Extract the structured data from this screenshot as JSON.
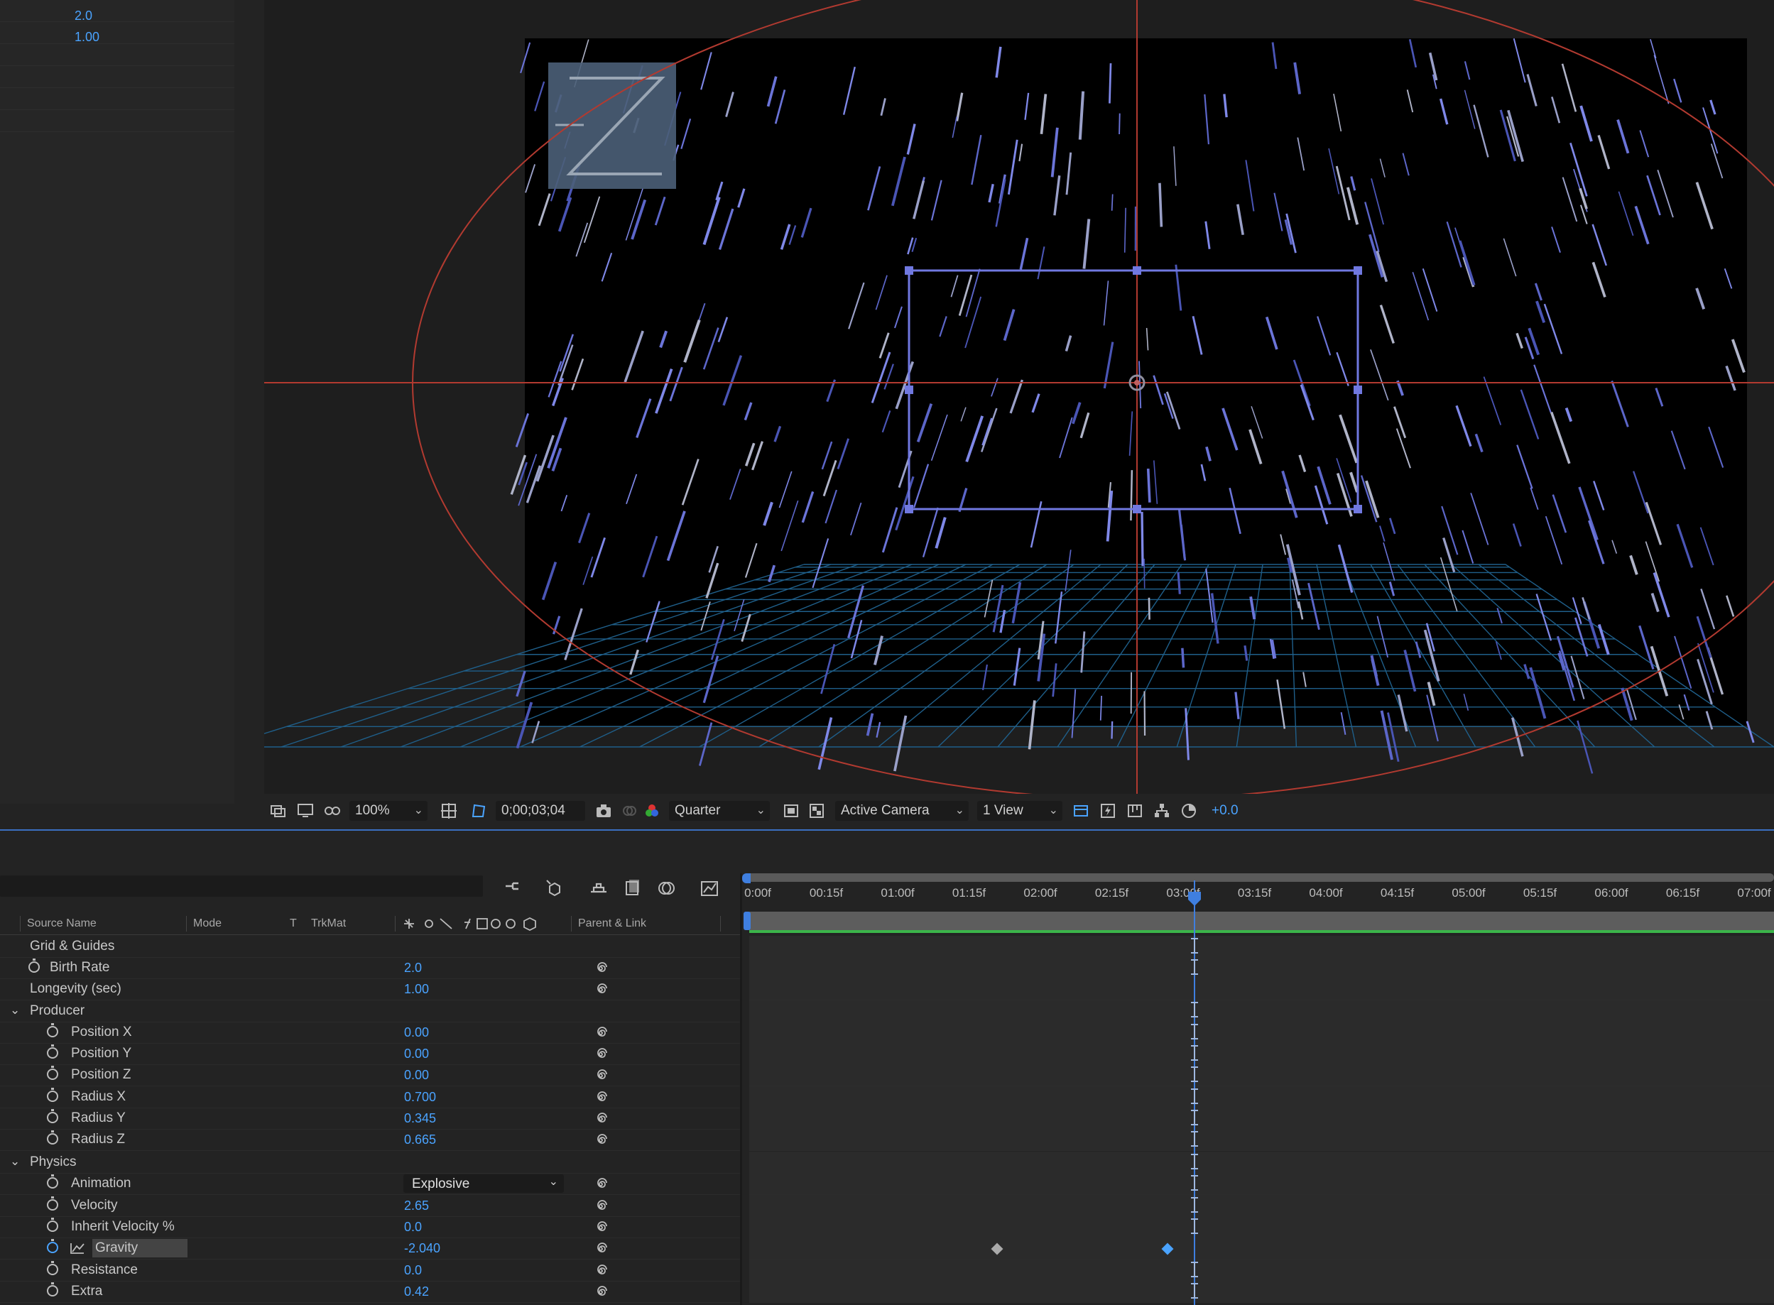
{
  "effect_panel": {
    "rows": [
      {
        "value": "2.0"
      },
      {
        "value": "1.00"
      }
    ]
  },
  "viewer_toolbar": {
    "zoom": "100%",
    "timecode": "0;00;03;04",
    "resolution": "Quarter",
    "camera": "Active Camera",
    "views": "1 View",
    "exposure": "+0.0"
  },
  "timeline": {
    "columns": {
      "source_name": "Source Name",
      "mode": "Mode",
      "t": "T",
      "trkmat": "TrkMat",
      "parent_link": "Parent & Link"
    },
    "ruler_labels": [
      "0:00f",
      "00:15f",
      "01:00f",
      "01:15f",
      "02:00f",
      "02:15f",
      "03:00f",
      "03:15f",
      "04:00f",
      "04:15f",
      "05:00f",
      "05:15f",
      "06:00f",
      "06:15f",
      "07:00f"
    ],
    "rows": {
      "grid_guides": {
        "name": "Grid & Guides"
      },
      "birth_rate": {
        "name": "Birth Rate",
        "value": "2.0"
      },
      "longevity": {
        "name": "Longevity (sec)",
        "value": "1.00"
      },
      "producer": {
        "name": "Producer"
      },
      "position_x": {
        "name": "Position X",
        "value": "0.00"
      },
      "position_y": {
        "name": "Position Y",
        "value": "0.00"
      },
      "position_z": {
        "name": "Position Z",
        "value": "0.00"
      },
      "radius_x": {
        "name": "Radius X",
        "value": "0.700"
      },
      "radius_y": {
        "name": "Radius Y",
        "value": "0.345"
      },
      "radius_z": {
        "name": "Radius Z",
        "value": "0.665"
      },
      "physics": {
        "name": "Physics"
      },
      "animation": {
        "name": "Animation",
        "value": "Explosive"
      },
      "velocity": {
        "name": "Velocity",
        "value": "2.65"
      },
      "inherit_velocity": {
        "name": "Inherit Velocity %",
        "value": "0.0"
      },
      "gravity": {
        "name": "Gravity",
        "value": "-2.040"
      },
      "resistance": {
        "name": "Resistance",
        "value": "0.0"
      },
      "extra": {
        "name": "Extra",
        "value": "0.42"
      }
    }
  },
  "colors": {
    "accent": "#4aa3ff",
    "playhead": "#3f7fe0",
    "guide_red": "#b23a30",
    "particle_blue": "#6b74d8",
    "grid_blue": "#1f5f8a"
  }
}
